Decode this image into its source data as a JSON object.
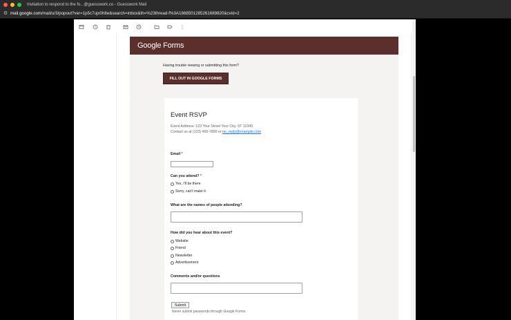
{
  "window": {
    "title": "Invitation to respond to the fo...@guesswork.co - Guesswork Mail"
  },
  "urlbar": {
    "host": "mail.google.com",
    "path": "/mail/u/3/popout?ver=1p5c7ujx0h8e&search=inbox&th=%23thread-f%3A1868501285261689820&cvid=2"
  },
  "toolbar": {
    "icons": [
      "archive-icon",
      "report-spam-icon",
      "delete-icon",
      "mark-unread-icon",
      "snooze-icon",
      "move-to-icon",
      "label-icon",
      "more-vert-icon"
    ]
  },
  "forms_header": {
    "logo_text": "Google Forms"
  },
  "banner": {
    "trouble_text": "Having trouble viewing or submitting this form?",
    "fill_button": "FILL OUT IN GOOGLE FORMS"
  },
  "form": {
    "title": "Event RSVP",
    "address_line": "Event Address: 123 Your Street Your City, ST 12345",
    "contact_prefix": "Contact us at (123) 456-7890 or ",
    "contact_email": "no_reply@example.com",
    "questions": {
      "email": {
        "label": "Email",
        "required_mark": "*"
      },
      "attend": {
        "label": "Can you attend?",
        "required_mark": "*",
        "options": [
          "Yes, I'll be there",
          "Sorry, can't make it"
        ]
      },
      "names": {
        "label": "What are the names of people attending?"
      },
      "hear": {
        "label": "How did you hear about this event?",
        "options": [
          "Website",
          "Friend",
          "Newsletter",
          "Advertisement"
        ]
      },
      "comments": {
        "label": "Comments and/or questions"
      }
    },
    "submit_label": "Submit",
    "never_text": "Never submit passwords through Google Forms."
  },
  "colors": {
    "forms_brand": "#5b2f2b",
    "link": "#1a73e8",
    "required": "#d93025"
  }
}
